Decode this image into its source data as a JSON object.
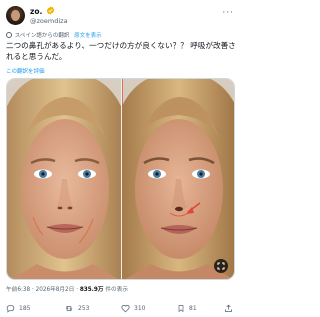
{
  "author": {
    "display_name": "zo.",
    "handle": "@zoemdiza"
  },
  "translation": {
    "label": "スペイン語からの翻訳",
    "original_link": "原文を表示"
  },
  "tweet": {
    "text": "二つの鼻孔があるより、一つだけの方が良くない？？ 呼吸が改善されると思うんだ。",
    "rate_translation": "この翻訳を評価"
  },
  "meta": {
    "time": "午前6:38",
    "separator": "·",
    "date": "2026年8月2日",
    "views_count": "835.9万",
    "views_label": "件の表示"
  },
  "actions": {
    "replies": "185",
    "retweets": "253",
    "likes": "310",
    "bookmarks": "81"
  },
  "colors": {
    "accent": "#1d9bf0",
    "verified": "#f4b400",
    "muted": "#536471"
  }
}
